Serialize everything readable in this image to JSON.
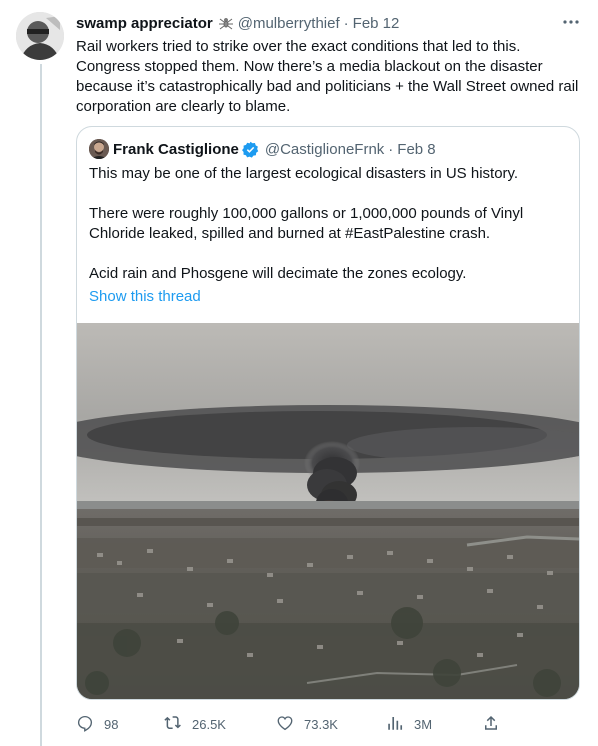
{
  "tweet": {
    "display_name": "swamp appreciator",
    "handle": "@mulberrythief",
    "separator": "·",
    "date": "Feb 12",
    "text": "Rail workers tried to strike over the exact conditions that led to this.\nCongress stopped them. Now there’s a media blackout on the disaster because it’s catastrophically bad and politicians + the Wall Street owned rail corporation are clearly to blame.",
    "more_icon": "more-icon"
  },
  "quote": {
    "display_name": "Frank Castiglione",
    "handle": "@CastiglioneFrnk",
    "separator": "·",
    "date": "Feb 8",
    "text": "This may be one of the largest ecological disasters in US history.\n\nThere were roughly 100,000 gallons or 1,000,000 pounds of Vinyl Chloride leaked, spilled and burned at #EastPalestine crash.\n\nAcid rain and Phosgene will decimate the zones ecology.",
    "show_thread": "Show this thread"
  },
  "actions": {
    "replies": "98",
    "retweets": "26.5K",
    "likes": "73.3K",
    "views": "3M"
  },
  "colors": {
    "link": "#1d9bf0",
    "muted": "#536471",
    "verified": "#1d9bf0"
  }
}
